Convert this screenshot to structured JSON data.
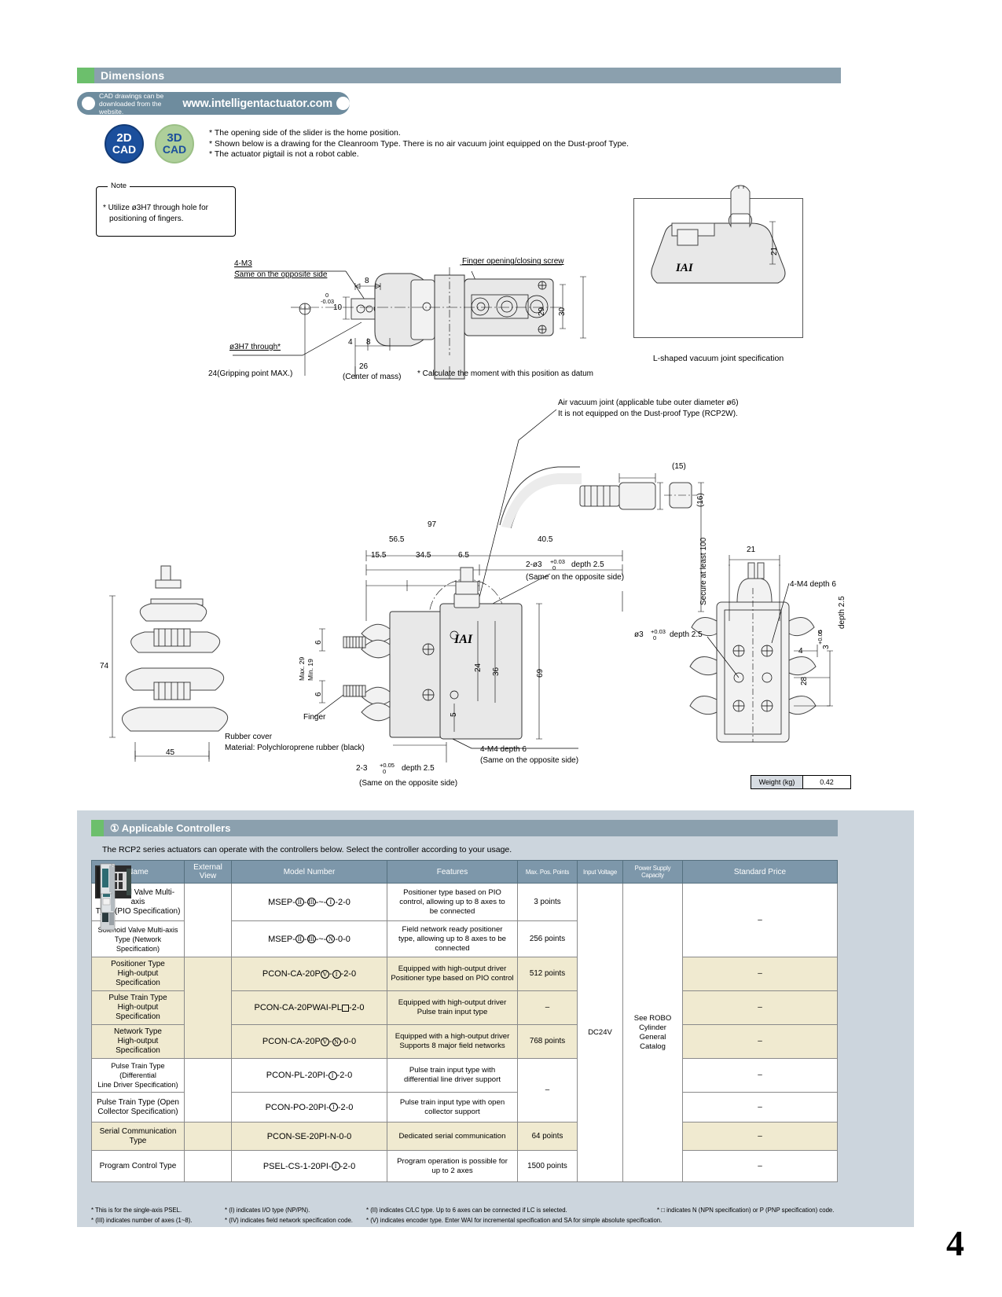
{
  "header": {
    "section_title": "Dimensions",
    "cad_note_line1": "CAD drawings can be",
    "cad_note_line2": "downloaded from the website.",
    "url": "www.intelligentactuator.com",
    "badge_2d_top": "2D",
    "badge_2d_bottom": "CAD",
    "badge_3d_top": "3D",
    "badge_3d_bottom": "CAD",
    "notes": [
      "* The opening side of the slider is the home position.",
      "* Shown below is a drawing for the Cleanroom Type. There is no air vacuum joint equipped on the Dust-proof Type.",
      "* The actuator pigtail is not a robot cable."
    ]
  },
  "note_box": {
    "label": "Note",
    "line1": "* Utilize ø3H7 through hole for",
    "line2": "positioning of fingers."
  },
  "inset": {
    "caption": "L-shaped vacuum joint specification",
    "dim_21": "21"
  },
  "top_drawing": {
    "lbl_4m3": "4-M3",
    "lbl_4m3_sub": "Same on the opposite side",
    "lbl_screw": "Finger opening/closing screw",
    "lbl_o3h7": "ø3H7 through*",
    "lbl_gripping": "24(Gripping point MAX.)",
    "lbl_center": "(Center of mass)",
    "lbl_moment": "* Calculate the moment with this position as datum",
    "d_8": "8",
    "d_10": "10",
    "d_tol_up": "0",
    "d_tol_lo": "-0.03",
    "d_4": "4",
    "d_8b": "8",
    "d_26": "26",
    "d_29": "29",
    "d_30": "30"
  },
  "main_drawing": {
    "vac_line1": "Air vacuum joint (applicable tube outer diameter ø6)",
    "vac_line2": "It is not equipped on the Dust-proof Type (RCP2W).",
    "d_97": "97",
    "d_565": "56.5",
    "d_405": "40.5",
    "d_155": "15.5",
    "d_345": "34.5",
    "d_65": "6.5",
    "lbl_2o3": "2-ø3",
    "lbl_2o3_up": "+0.03",
    "lbl_2o3_lo": "0",
    "lbl_2o3_depth": "depth 2.5",
    "lbl_2o3_same": "(Same on the opposite side)",
    "d_15": "(15)",
    "d_16": "(16)",
    "lbl_secure": "Secure at least 100",
    "d_74": "74",
    "d_45": "45",
    "d_max29": "Max. 29",
    "d_min19": "Min. 19",
    "d_6a": "6",
    "d_6b": "6",
    "lbl_finger": "Finger",
    "lbl_rubber1": "Rubber cover",
    "lbl_rubber2": "Material: Polychloroprene rubber (black)",
    "d_24": "24",
    "d_36": "36",
    "d_69": "69",
    "d_5": "5",
    "lbl_4m4": "4-M4 depth 6",
    "lbl_4m4_same": "(Same on the opposite side)",
    "lbl_23": "2-3",
    "lbl_23_up": "+0.05",
    "lbl_23_lo": "0",
    "lbl_23_depth": "depth 2.5",
    "lbl_23_same": "(Same on the opposite side)",
    "logo": "IAI"
  },
  "right_drawing": {
    "d_21": "21",
    "lbl_4m4": "4-M4 depth 6",
    "lbl_depth25_v": "depth 2.5",
    "lbl_o3": "ø3",
    "lbl_o3_up": "+0.03",
    "lbl_o3_lo": "0",
    "lbl_o3_depth": "depth 2.5",
    "d_4": "4",
    "d_3": "3",
    "d_3_up": "+0.05",
    "d_3_lo": "0",
    "d_28": "28"
  },
  "weight": {
    "label": "Weight (kg)",
    "value": "0.42"
  },
  "controllers": {
    "heading": "① Applicable Controllers",
    "subtitle": "The RCP2 series actuators can operate with the controllers below. Select the controller according to your usage.",
    "columns": [
      "Name",
      "External View",
      "Model Number",
      "Features",
      "Max. Pos. Points",
      "Input Voltage",
      "Power Supply Capacity",
      "Standard Price"
    ],
    "input_voltage": "DC24V",
    "power_supply": "See ROBO Cylinder General Catalog",
    "power_supply_lines": [
      "See ROBO",
      "Cylinder",
      "General Catalog"
    ],
    "rows": [
      {
        "name_lines": [
          "Solenoid Valve Multi-axis",
          "Type (PIO Specification)"
        ],
        "model": "MSEP-(II)-(III)-~-(I)-2-0",
        "model_parts": [
          "MSEP-",
          "II",
          "-",
          "III",
          "-~-",
          "I",
          "-2-0"
        ],
        "feature_lines": [
          "Positioner type based on PIO",
          "control, allowing up to 8 axes to",
          "be connected"
        ],
        "points": "3 points",
        "price": "",
        "shaded": false
      },
      {
        "name_lines": [
          "Solenoid Valve Multi-axis",
          "Type (Network Specification)"
        ],
        "model_parts": [
          "MSEP-",
          "II",
          "-",
          "III",
          "-~-",
          "N",
          "-0-0"
        ],
        "feature_lines": [
          "Field network ready positioner",
          "type, allowing up to 8 axes to be",
          "connected"
        ],
        "points": "256 points",
        "price": "–",
        "shaded": false
      },
      {
        "name_lines": [
          "Positioner Type",
          "High-output Specification"
        ],
        "model_parts": [
          "PCON-CA-20P",
          "V",
          "-",
          "I",
          "-2-0"
        ],
        "feature_lines": [
          "Equipped with high-output driver",
          "Positioner type based on PIO control"
        ],
        "points": "512 points",
        "price": "–",
        "shaded": true
      },
      {
        "name_lines": [
          "Pulse Train Type",
          "High-output Specification"
        ],
        "model_parts": [
          "PCON-CA-20PWAI-PL",
          "□",
          "-2-0"
        ],
        "feature_lines": [
          "Equipped with high-output driver",
          "Pulse train input type"
        ],
        "points": "–",
        "price": "–",
        "shaded": true
      },
      {
        "name_lines": [
          "Network Type",
          "High-output Specification"
        ],
        "model_parts": [
          "PCON-CA-20P",
          "V",
          "-",
          "N",
          "-0-0"
        ],
        "feature_lines": [
          "Equipped with a high-output driver",
          "Supports 8 major field networks"
        ],
        "points": "768 points",
        "price": "–",
        "shaded": true
      },
      {
        "name_lines": [
          "Pulse Train Type (Differential",
          "Line Driver Specification)"
        ],
        "model_parts": [
          "PCON-PL-20PI-",
          "I",
          "-2-0"
        ],
        "feature_lines": [
          "Pulse train input type with",
          "differential line driver support"
        ],
        "points": "–",
        "price": "–",
        "shaded": false
      },
      {
        "name_lines": [
          "Pulse Train Type (Open",
          "Collector Specification)"
        ],
        "model_parts": [
          "PCON-PO-20PI-",
          "I",
          "-2-0"
        ],
        "feature_lines": [
          "Pulse train input type with open",
          "collector support"
        ],
        "points": "",
        "price": "–",
        "shaded": false
      },
      {
        "name_lines": [
          "Serial Communication",
          "Type"
        ],
        "model_parts": [
          "PCON-SE-20PI-N-0-0"
        ],
        "feature_lines": [
          "Dedicated serial communication"
        ],
        "points": "64 points",
        "price": "–",
        "shaded": true
      },
      {
        "name_lines": [
          "Program Control Type"
        ],
        "model_parts": [
          "PSEL-CS-1-20PI-",
          "I",
          "-2-0"
        ],
        "feature_lines": [
          "Program operation is possible for",
          "up to 2 axes"
        ],
        "points": "1500 points",
        "price": "–",
        "shaded": false
      }
    ],
    "footnotes": [
      "* This is for the single-axis PSEL.",
      "* (I) indicates I/O type (NP/PN).",
      "* (II) indicates C/LC type. Up to 6 axes can be connected if LC is selected.",
      "* □ indicates N (NPN specification) or P (PNP specification) code.",
      "* (III) indicates number of axes (1~8).",
      "* (IV) indicates field network specification code.",
      "* (V) indicates encoder type. Enter WAI for incremental specification and SA for simple absolute specification."
    ]
  },
  "page_number": "4",
  "colors": {
    "bar": "#8ba0ae",
    "accent_green": "#6cbf6c",
    "section_bg": "#ccd5dd",
    "row_shaded": "#f0ead0",
    "header_cell": "#7d97aa"
  }
}
